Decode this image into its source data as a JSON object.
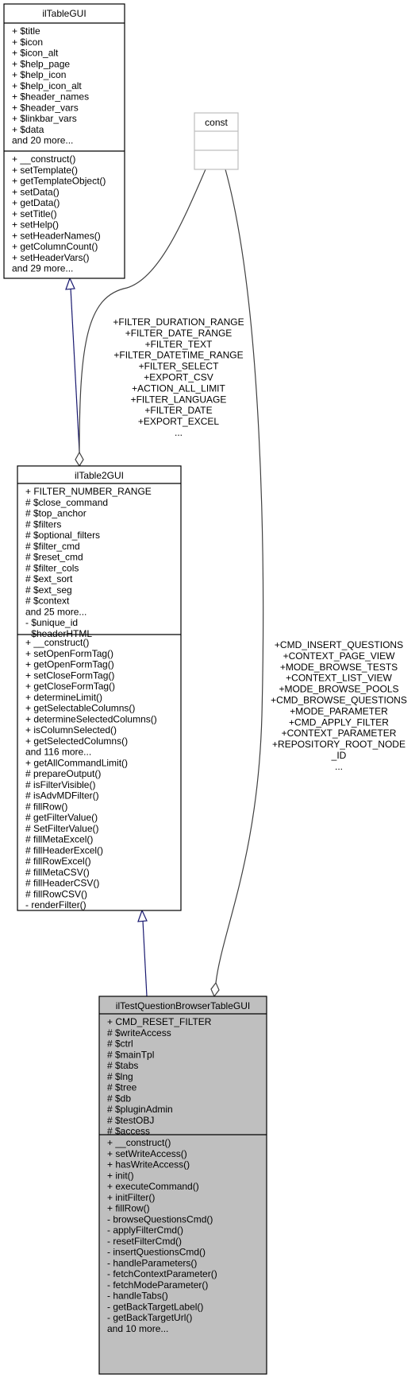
{
  "colors": {
    "inheritance_edge": "#191970",
    "aggregation_edge": "#404040",
    "focus_class_fill": "#bfbfbf",
    "const_border": "#bfbfbf"
  },
  "classes": {
    "ilTableGUI": {
      "name": "ilTableGUI",
      "attributes": [
        "+ $title",
        "+ $icon",
        "+ $icon_alt",
        "+ $help_page",
        "+ $help_icon",
        "+ $help_icon_alt",
        "+ $header_names",
        "+ $header_vars",
        "+ $linkbar_vars",
        "+ $data",
        "and 20 more..."
      ],
      "methods": [
        "+ __construct()",
        "+ setTemplate()",
        "+ getTemplateObject()",
        "+ setData()",
        "+ getData()",
        "+ setTitle()",
        "+ setHelp()",
        "+ setHeaderNames()",
        "+ getColumnCount()",
        "+ setHeaderVars()",
        "and 29 more..."
      ]
    },
    "const": {
      "name": "const",
      "attributes": [],
      "methods": []
    },
    "ilTable2GUI": {
      "name": "ilTable2GUI",
      "attributes": [
        "+ FILTER_NUMBER_RANGE",
        "# $close_command",
        "# $top_anchor",
        "# $filters",
        "# $optional_filters",
        "# $filter_cmd",
        "# $reset_cmd",
        "# $filter_cols",
        "# $ext_sort",
        "# $ext_seg",
        "# $context",
        "and 25 more...",
        "- $unique_id",
        "- $headerHTML"
      ],
      "methods": [
        "+ __construct()",
        "+ setOpenFormTag()",
        "+ getOpenFormTag()",
        "+ setCloseFormTag()",
        "+ getCloseFormTag()",
        "+ determineLimit()",
        "+ getSelectableColumns()",
        "+ determineSelectedColumns()",
        "+ isColumnSelected()",
        "+ getSelectedColumns()",
        "and 116 more...",
        "+ getAllCommandLimit()",
        "# prepareOutput()",
        "# isFilterVisible()",
        "# isAdvMDFilter()",
        "# fillRow()",
        "# getFilterValue()",
        "# SetFilterValue()",
        "# fillMetaExcel()",
        "# fillHeaderExcel()",
        "# fillRowExcel()",
        "# fillMetaCSV()",
        "# fillHeaderCSV()",
        "# fillRowCSV()",
        "- renderFilter()"
      ]
    },
    "ilTestQuestionBrowserTableGUI": {
      "name": "ilTestQuestionBrowserTableGUI",
      "attributes": [
        "+ CMD_RESET_FILTER",
        "# $writeAccess",
        "# $ctrl",
        "# $mainTpl",
        "# $tabs",
        "# $lng",
        "# $tree",
        "# $db",
        "# $pluginAdmin",
        "# $testOBJ",
        "# $access"
      ],
      "methods": [
        "+ __construct()",
        "+ setWriteAccess()",
        "+ hasWriteAccess()",
        "+ init()",
        "+ executeCommand()",
        "+ initFilter()",
        "+ fillRow()",
        "- browseQuestionsCmd()",
        "- applyFilterCmd()",
        "- resetFilterCmd()",
        "- insertQuestionsCmd()",
        "- handleParameters()",
        "- fetchContextParameter()",
        "- fetchModeParameter()",
        "- handleTabs()",
        "- getBackTargetLabel()",
        "- getBackTargetUrl()",
        "and 10 more..."
      ]
    }
  },
  "edges": {
    "const_to_ilTable2GUI": [
      "+FILTER_DURATION_RANGE",
      "+FILTER_DATE_RANGE",
      "+FILTER_TEXT",
      "+FILTER_DATETIME_RANGE",
      "+FILTER_SELECT",
      "+EXPORT_CSV",
      "+ACTION_ALL_LIMIT",
      "+FILTER_LANGUAGE",
      "+FILTER_DATE",
      "+EXPORT_EXCEL",
      "..."
    ],
    "const_to_ilTestQuestionBrowserTableGUI": [
      "+CMD_INSERT_QUESTIONS",
      "+CONTEXT_PAGE_VIEW",
      "+MODE_BROWSE_TESTS",
      "+CONTEXT_LIST_VIEW",
      "+MODE_BROWSE_POOLS",
      "+CMD_BROWSE_QUESTIONS",
      "+MODE_PARAMETER",
      "+CMD_APPLY_FILTER",
      "+CONTEXT_PARAMETER",
      "+REPOSITORY_ROOT_NODE",
      "_ID",
      "..."
    ]
  }
}
